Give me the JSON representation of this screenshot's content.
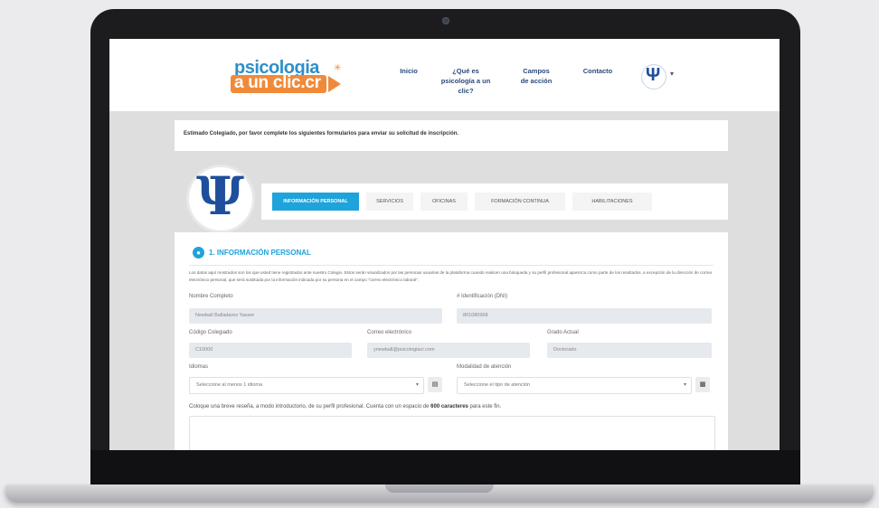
{
  "header": {
    "logo_line1": "psicologia",
    "logo_line2": "a un clic.cr",
    "nav": [
      {
        "label": "Inicio"
      },
      {
        "label": "¿Qué es psicología a un clic?"
      },
      {
        "label": "Campos de acción"
      },
      {
        "label": "Contacto"
      }
    ],
    "avatar_glyph": "Ψ",
    "avatar_caret": "▾"
  },
  "notice": {
    "text": "Estimado Colegiado, por favor complete los siguientes formularios para enviar su solicitud de inscripción."
  },
  "profile": {
    "glyph": "Ψ"
  },
  "tabs": [
    {
      "label": "INFORMACIÓN PERSONAL",
      "active": true
    },
    {
      "label": "SERVICIOS",
      "active": false
    },
    {
      "label": "OFICINAS",
      "active": false
    },
    {
      "label": "FORMACIÓN CONTINUA",
      "active": false
    },
    {
      "label": "HABILITACIONES",
      "active": false
    }
  ],
  "form": {
    "section_title": "1. INFORMACIÓN PERSONAL",
    "description": "Los datos aquí mostrados son los que usted tiene registrados ante nuestro Colegio. Estos serán visualizados por las personas usuarias de la plataforma cuando realicen una búsqueda y su perfil profesional aparezca como parte de los resultados, a excepción de la dirección de correo electrónico personal, que será sustituida por la información indicada por su persona en el campo \"correo electrónico laboral\".",
    "fields": {
      "nombre": {
        "label": "Nombre Completo",
        "value": "Newball Balladares Yasser"
      },
      "identificacion": {
        "label": "# Identificación (DNI)",
        "value": "801080968"
      },
      "codigo": {
        "label": "Código Colegiado",
        "value": "C10000"
      },
      "correo": {
        "label": "Correo electrónico",
        "value": "ynewball@psicologiacr.com"
      },
      "grado": {
        "label": "Grado Actual",
        "value": "Doctorado"
      },
      "idiomas": {
        "label": "Idiomas",
        "value": "Seleccione al menos 1 idioma"
      },
      "modalidad": {
        "label": "Modalidad de atención",
        "value": "Seleccione el tipo de atención"
      }
    },
    "bio_label_pre": "Coloque una breve reseña, a modo introductorio, de su perfil profesional. Cuenta con un espacio de ",
    "bio_label_bold": "600 caracteres",
    "bio_label_post": " para este fin.",
    "bio_value": ""
  }
}
